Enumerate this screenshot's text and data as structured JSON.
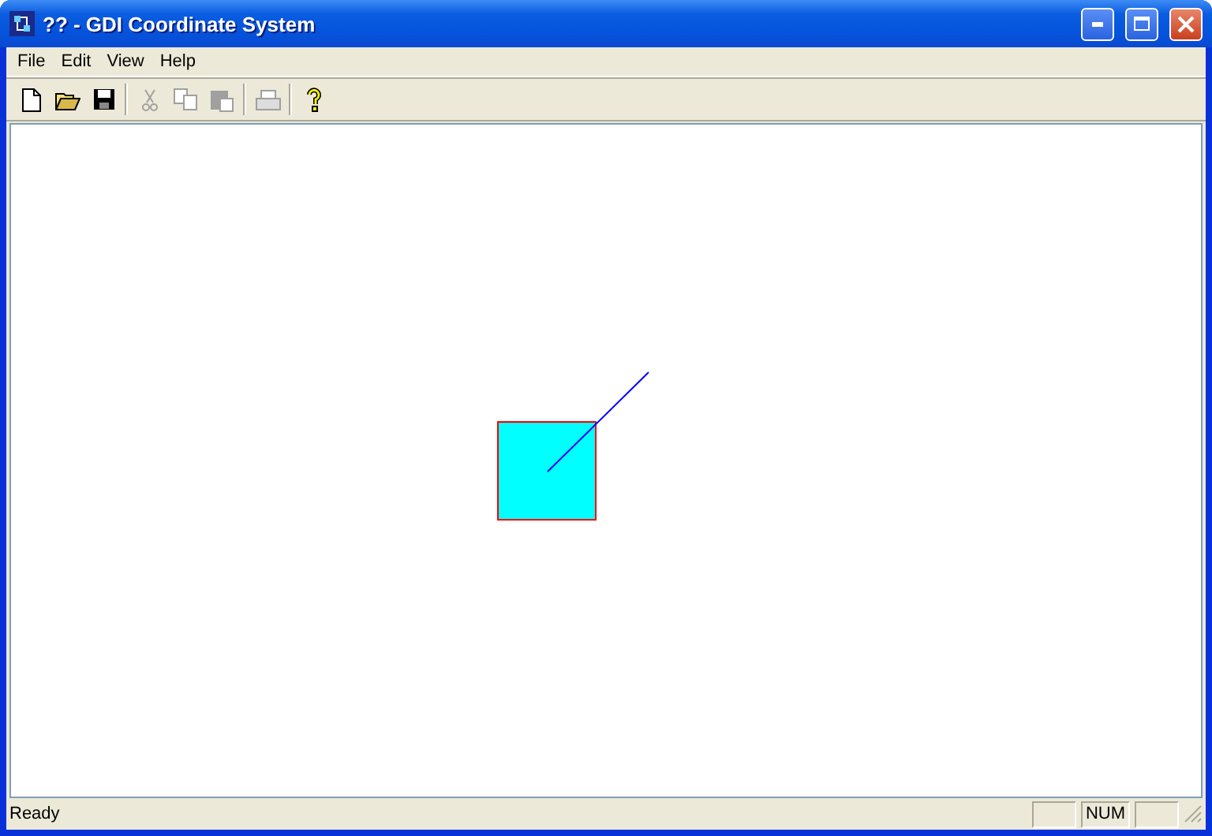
{
  "window": {
    "title": "?? - GDI Coordinate System"
  },
  "menu": [
    "File",
    "Edit",
    "View",
    "Help"
  ],
  "toolbar": [
    {
      "kind": "new",
      "disabled": false
    },
    {
      "kind": "open",
      "disabled": false
    },
    {
      "kind": "save",
      "disabled": false
    },
    {
      "kind": "separator"
    },
    {
      "kind": "cut",
      "disabled": true
    },
    {
      "kind": "copy",
      "disabled": true
    },
    {
      "kind": "paste",
      "disabled": true
    },
    {
      "kind": "separator"
    },
    {
      "kind": "print",
      "disabled": true
    },
    {
      "kind": "separator"
    },
    {
      "kind": "help",
      "disabled": false
    }
  ],
  "status_bar": {
    "message": "Ready",
    "panes": [
      {
        "kind": "empty"
      },
      {
        "kind": "text",
        "text": "NUM"
      },
      {
        "kind": "empty"
      }
    ]
  }
}
